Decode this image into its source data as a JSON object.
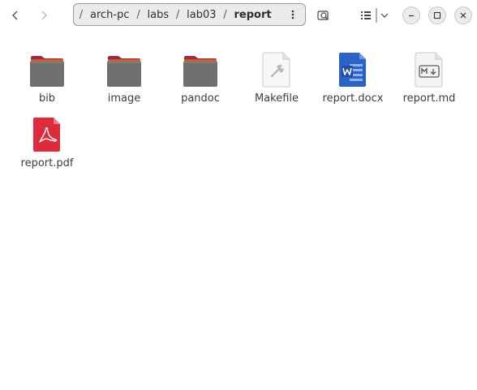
{
  "header": {
    "root_separator": "/",
    "breadcrumbs": [
      {
        "label": "arch-pc"
      },
      {
        "label": "labs"
      },
      {
        "label": "lab03"
      },
      {
        "label": "report"
      }
    ],
    "separator": "/",
    "path_menu_icon": "vertical-ellipsis",
    "search_icon": "search",
    "view_icon": "list-view",
    "view_dropdown_icon": "chevron-down",
    "window_controls": [
      "minimize",
      "maximize",
      "close"
    ]
  },
  "files": [
    {
      "name": "bib",
      "type": "folder"
    },
    {
      "name": "image",
      "type": "folder"
    },
    {
      "name": "pandoc",
      "type": "folder"
    },
    {
      "name": "Makefile",
      "type": "makefile"
    },
    {
      "name": "report.docx",
      "type": "docx"
    },
    {
      "name": "report.md",
      "type": "markdown"
    },
    {
      "name": "report.pdf",
      "type": "pdf"
    }
  ],
  "colors": {
    "folder_tab": "#a0284e",
    "folder_body": "#6f6f6f",
    "docx_blue": "#2b63c5",
    "pdf_red": "#dd2b3b"
  }
}
